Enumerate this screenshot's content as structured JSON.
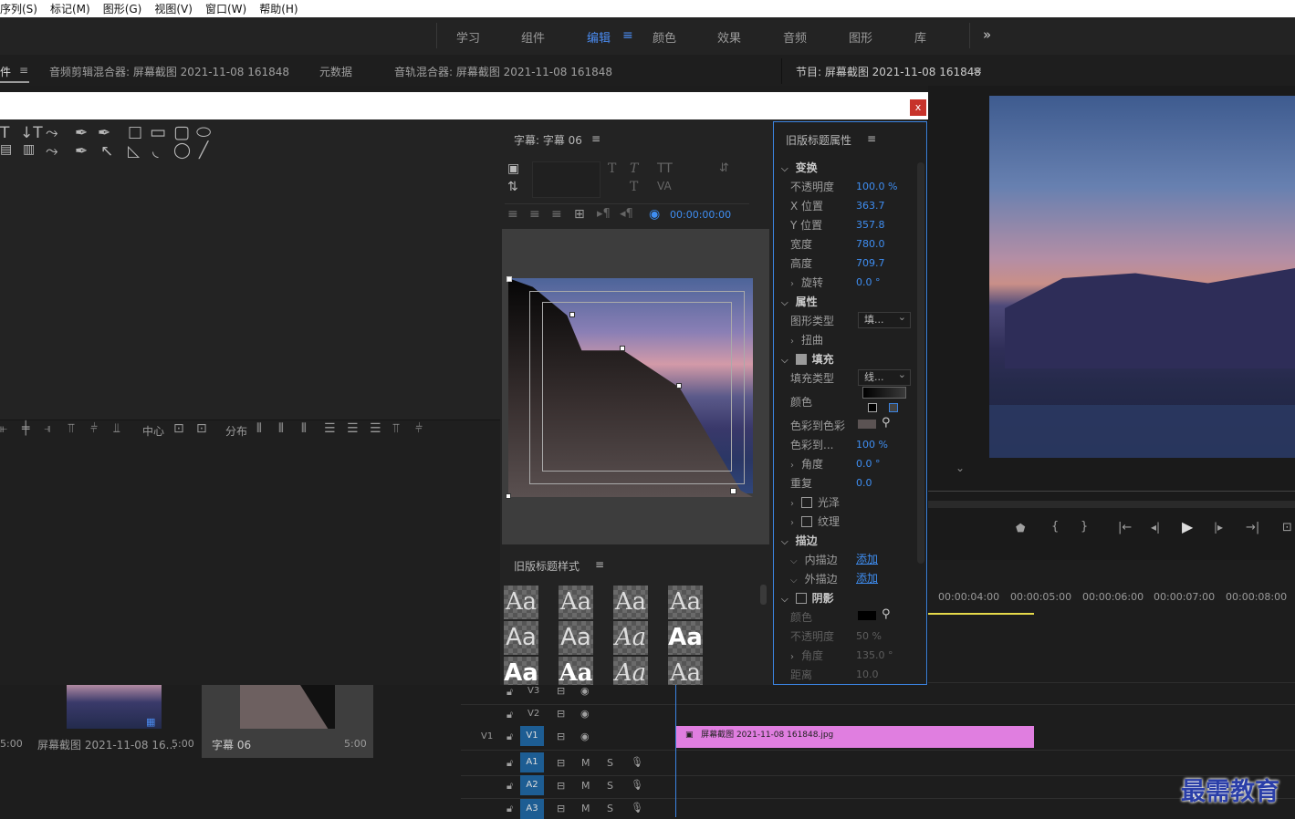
{
  "menu": [
    "序列(S)",
    "标记(M)",
    "图形(G)",
    "视图(V)",
    "窗口(W)",
    "帮助(H)"
  ],
  "workspaces": [
    "学习",
    "组件",
    "编辑",
    "颜色",
    "效果",
    "音频",
    "图形",
    "库"
  ],
  "workspace_active": "编辑",
  "overflow": "»",
  "panel_tabs": {
    "project_tab": "件",
    "audio_clip_mixer": "音频剪辑混合器: 屏幕截图 2021-11-08 161848",
    "metadata": "元数据",
    "audio_track_mixer": "音轨混合器: 屏幕截图 2021-11-08 161848",
    "program_monitor": "节目: 屏幕截图 2021-11-08 161848"
  },
  "dialog": {
    "close": "x",
    "title_panel": "字幕: 字幕 06",
    "timecode": "00:00:00:00",
    "align_center": "中心",
    "distribute": "分布",
    "styles_panel": "旧版标题样式",
    "style_sample": "Aa"
  },
  "properties": {
    "header": "旧版标题属性",
    "transform": "变换",
    "opacity_label": "不透明度",
    "opacity": "100.0 %",
    "x_label": "X 位置",
    "x": "363.7",
    "y_label": "Y 位置",
    "y": "357.8",
    "width_label": "宽度",
    "width": "780.0",
    "height_label": "高度",
    "height": "709.7",
    "rotation_label": "旋转",
    "rotation": "0.0 °",
    "attributes": "属性",
    "graphic_type_label": "图形类型",
    "graphic_type": "填...",
    "distort": "扭曲",
    "fill": "填充",
    "fill_type_label": "填充类型",
    "fill_type": "线...",
    "color_label": "颜色",
    "color_to_color": "色彩到色彩",
    "color_to_label": "色彩到...",
    "color_to": "100 %",
    "angle_label": "角度",
    "angle": "0.0 °",
    "repeat_label": "重复",
    "repeat": "0.0",
    "sheen": "光泽",
    "texture": "纹理",
    "stroke": "描边",
    "inner_stroke": "内描边",
    "inner_add": "添加",
    "outer_stroke": "外描边",
    "outer_add": "添加",
    "shadow": "阴影",
    "shadow_color_label": "颜色",
    "shadow_opacity_label": "不透明度",
    "shadow_opacity": "50 %",
    "shadow_angle_label": "角度",
    "shadow_angle": "135.0 °",
    "shadow_distance_label": "距离",
    "shadow_distance": "10.0"
  },
  "project_items": [
    {
      "name": "屏幕截图 2021-11-08 16...",
      "duration": "5:00"
    },
    {
      "name": "字幕 06",
      "duration": "5:00"
    }
  ],
  "first_item_duration": "5:00",
  "timeline": {
    "ruler": [
      "00:00:04:00",
      "00:00:05:00",
      "00:00:06:00",
      "00:00:07:00",
      "00:00:08:00"
    ],
    "tracks": [
      "V3",
      "V2",
      "V1",
      "A1",
      "A2",
      "A3"
    ],
    "source_v1": "V1",
    "clip": "屏幕截图 2021-11-08 161848.jpg",
    "m": "M",
    "s": "S"
  },
  "watermark": "最需教育",
  "colors": {
    "accent": "#3f8ef2",
    "clip": "#e07ee0",
    "close": "#c7332b"
  }
}
